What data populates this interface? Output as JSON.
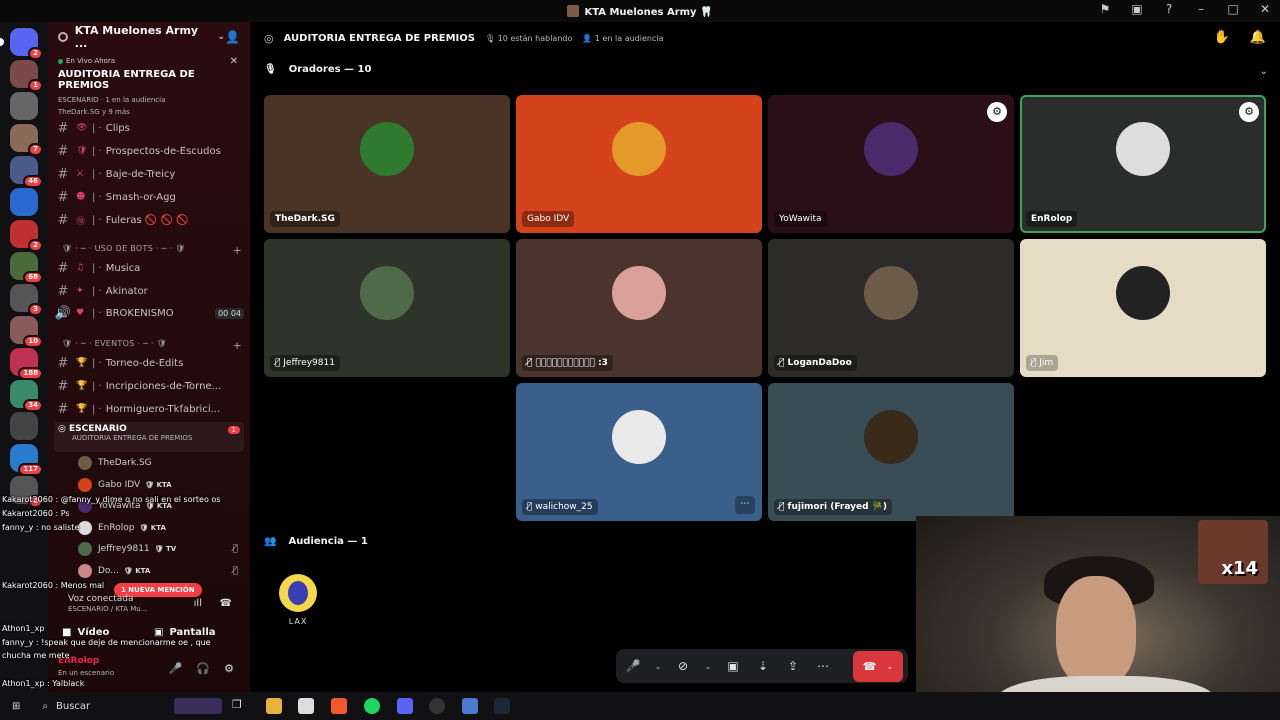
{
  "window": {
    "title": "KTA Muelones Army 🦷"
  },
  "sidebar": {
    "server_name": "KTA Muelones Army ...",
    "live_label": "En Vivo Ahora",
    "live_stage_title": "AUDITORIA ENTREGA DE PREMIOS",
    "live_meta": "ESCENARIO · 1 en la audiencia",
    "live_meta2": "TheDark.SG y 9 más",
    "channels": [
      {
        "name": "Clips",
        "emoji": "👁"
      },
      {
        "name": "Prospectos-de-Escudos",
        "emoji": "🛡"
      },
      {
        "name": "Baje-de-Treicy",
        "emoji": "⚔"
      },
      {
        "name": "Smash-or-Agg",
        "emoji": "☻"
      },
      {
        "name": "Fuleras 🚫 🚫 🚫",
        "emoji": "⑱"
      }
    ],
    "cat_bots": "USO DE BOTS",
    "bot_channels": [
      {
        "name": "Musica",
        "emoji": "♫"
      },
      {
        "name": "Akinator",
        "emoji": "✦"
      }
    ],
    "voice_channel": {
      "name": "BROKENISMO",
      "emoji": "♥",
      "c1": "00",
      "c2": "04"
    },
    "cat_events": "EVENTOS",
    "event_channels": [
      {
        "name": "Torneo-de-Edits",
        "emoji": "🏆"
      },
      {
        "name": "Incripciones-de-Torne...",
        "emoji": "🏆"
      },
      {
        "name": "Hormiguero-Tkfabrici...",
        "emoji": "🏆"
      }
    ],
    "stage_channel": {
      "name": "ESCENARIO",
      "sub": "AUDITORIA ENTREGA DE PREMIOS",
      "badge": "1"
    },
    "stage_members": [
      {
        "name": "TheDark.SG",
        "tag": ""
      },
      {
        "name": "Gabo IDV",
        "tag": "KTA"
      },
      {
        "name": "YoWawita",
        "tag": "KTA"
      },
      {
        "name": "EnRolop",
        "tag": "KTA"
      },
      {
        "name": "Jeffrey9811",
        "tag": "TV"
      },
      {
        "name": "Do...",
        "tag": "KTA"
      }
    ],
    "mention_pill": "1 NUEVA MENCIÓN",
    "voice_status": "Voz conectada",
    "voice_sub": "ESCENARIO / KTA Mu...",
    "video_btn": "Vídeo",
    "screen_btn": "Pantalla",
    "user_name": "EnRolop",
    "user_sub": "En un escenario"
  },
  "rail": {
    "badges": [
      "2",
      "1",
      "",
      "7",
      "46",
      "",
      "2",
      "68",
      "3",
      "10",
      "188",
      "34",
      "",
      "117",
      "2"
    ]
  },
  "chat": [
    "Kakarot2060 : @fanny_y dime q no sali en el sorteo os",
    "Kakarot2060 : Ps",
    "fanny_y : no saliste",
    "Kakarot2060 : Menos mal",
    "Athon1_xp",
    "fanny_y : !speak que deje de mencionarme oe , que",
    "chucha me mete",
    "Athon1_xp : Yalblack",
    "Athon1_xp"
  ],
  "stage": {
    "title": "AUDITORIA ENTREGA DE PREMIOS",
    "speaking_count": "10 están hablando",
    "audience_count": "1 en la audiencia",
    "speakers_header": "Oradores — 10",
    "audience_header": "Audiencia — 1",
    "speakers": [
      {
        "name": "TheDark.SG",
        "bg": "#4a3426",
        "av": "#2f7a2f",
        "bold": true
      },
      {
        "name": "Gabo IDV",
        "bg": "#d4431c",
        "av": "#e39a2a",
        "bold": false
      },
      {
        "name": "YoWawita",
        "bg": "#2a0f18",
        "av": "#4a2a6a",
        "bold": false,
        "corner": true
      },
      {
        "name": "EnRolop",
        "bg": "#2a2d2c",
        "av": "#ddd",
        "bold": true,
        "corner": true,
        "speaking": true
      },
      {
        "name": "Jeffrey9811",
        "bg": "#2e3429",
        "av": "#4f6a4a",
        "bold": false,
        "muted": true
      },
      {
        "name": "𝓓𝓸𝓷𝓒𝓸𝓶𝓮𝓭𝓲𝓪𝓼 :3",
        "bg": "#4a342d",
        "av": "#d9a19a",
        "bold": true,
        "muted": true
      },
      {
        "name": "LoganDaDoo",
        "bg": "#2c2b2a",
        "av": "#6d5b4a",
        "bold": true,
        "muted": true
      },
      {
        "name": "Jim",
        "bg": "#e6dcc6",
        "av": "#222",
        "bold": false,
        "muted": true
      },
      {
        "name": "walichow_25",
        "bg": "#3a5f8a",
        "av": "#eaeaea",
        "bold": false,
        "muted": true,
        "more": true
      },
      {
        "name": "fujimori (Frayed 🎋)",
        "bg": "#394d57",
        "av": "#3a2a1a",
        "bold": true,
        "muted": true
      }
    ],
    "audience": [
      {
        "name": "LAX"
      }
    ]
  },
  "colors": {
    "accent_green": "#3ba55d",
    "leave_red": "#da373c",
    "badge_red": "#f23f43"
  },
  "taskbar": {
    "search": "Buscar"
  }
}
